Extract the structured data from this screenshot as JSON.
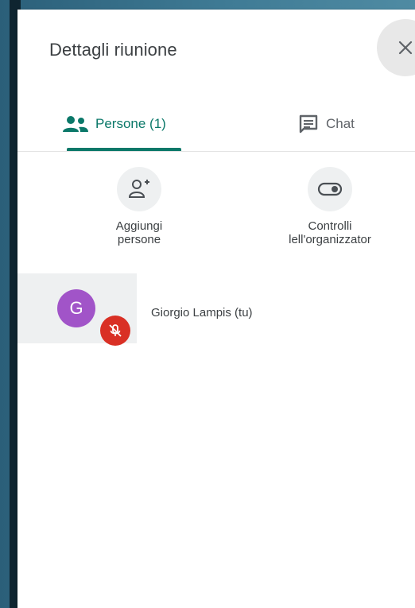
{
  "header": {
    "title": "Dettagli riunione",
    "close_icon": "close-icon"
  },
  "tabs": [
    {
      "label": "Persone (1)",
      "icon": "people-icon",
      "active": true
    },
    {
      "label": "Chat",
      "icon": "chat-icon",
      "active": false
    }
  ],
  "actions": [
    {
      "label": "Aggiungi\npersone",
      "icon": "add-person-icon"
    },
    {
      "label": "Controlli\nlell'organizzator",
      "icon": "toggle-icon"
    }
  ],
  "participants": [
    {
      "initial": "G",
      "name": "Giorgio Lampis (tu)",
      "muted": true,
      "avatar_color": "#a154c8",
      "mute_color": "#d93025"
    }
  ],
  "colors": {
    "accent": "#0b7869",
    "text": "#3c4043",
    "muted_red": "#d93025",
    "avatar": "#a154c8"
  }
}
